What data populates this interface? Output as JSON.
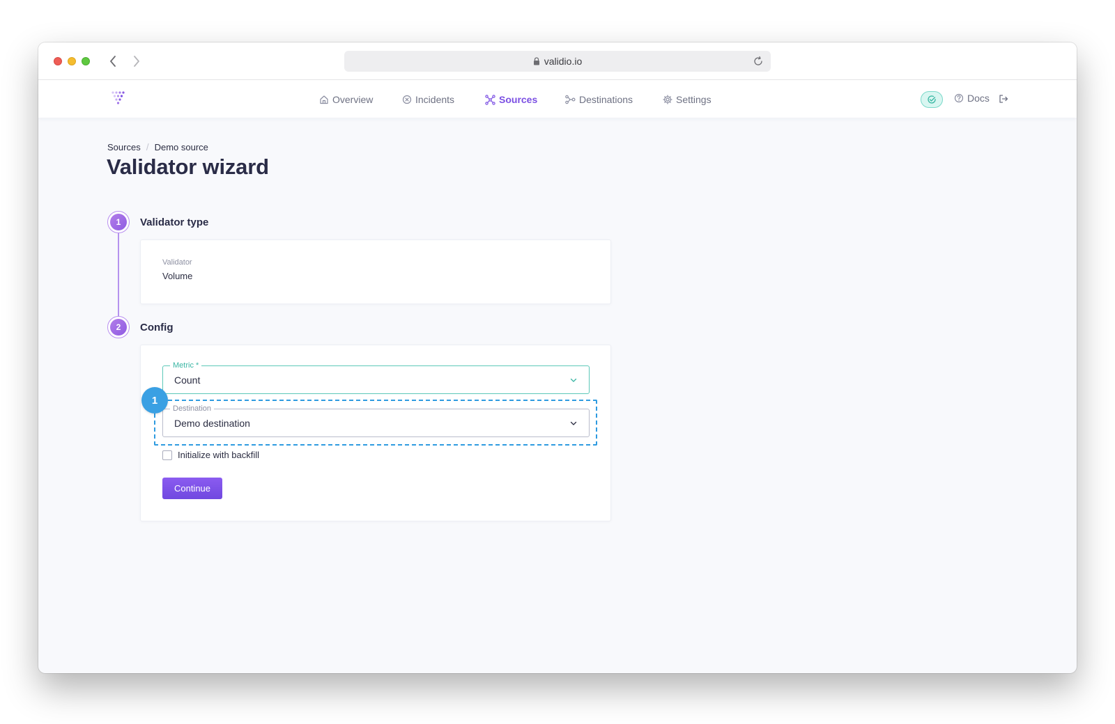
{
  "browser": {
    "url": "validio.io"
  },
  "nav": {
    "items": [
      {
        "label": "Overview",
        "icon": "home-icon",
        "active": false
      },
      {
        "label": "Incidents",
        "icon": "x-circle-icon",
        "active": false
      },
      {
        "label": "Sources",
        "icon": "sources-icon",
        "active": true
      },
      {
        "label": "Destinations",
        "icon": "destinations-icon",
        "active": false
      },
      {
        "label": "Settings",
        "icon": "gear-icon",
        "active": false
      }
    ],
    "docs_label": "Docs",
    "accent_color": "#7b4fe3"
  },
  "breadcrumb": {
    "items": [
      "Sources",
      "Demo source"
    ],
    "separator": "/"
  },
  "page_title": "Validator wizard",
  "steps": [
    {
      "number": "1",
      "title": "Validator type",
      "field_label": "Validator",
      "field_value": "Volume"
    },
    {
      "number": "2",
      "title": "Config",
      "metric": {
        "label": "Metric *",
        "value": "Count"
      },
      "destination": {
        "label": "Destination",
        "value": "Demo destination"
      },
      "backfill_label": "Initialize with backfill",
      "backfill_checked": false,
      "continue_label": "Continue"
    }
  ],
  "annotation_badge": "1"
}
